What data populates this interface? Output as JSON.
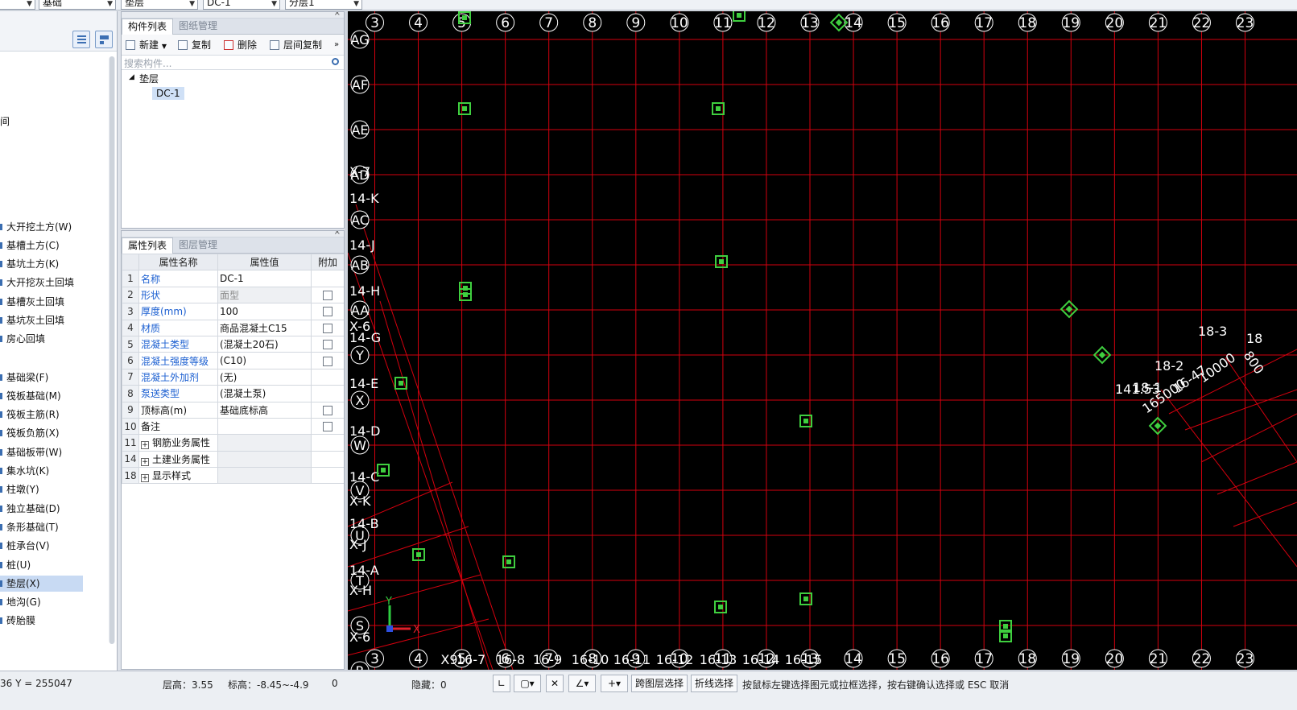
{
  "top_combos": {
    "c1": "",
    "c2": "基础",
    "c3": "垫层",
    "c4": "DC-1",
    "c5": "分层1"
  },
  "left_tree": {
    "items": [
      {
        "label": "大开挖土方(W)"
      },
      {
        "label": "基槽土方(C)"
      },
      {
        "label": "基坑土方(K)"
      },
      {
        "label": "大开挖灰土回填"
      },
      {
        "label": "基槽灰土回填"
      },
      {
        "label": "基坑灰土回填"
      },
      {
        "label": "房心回填"
      },
      {
        "label": "基础梁(F)"
      },
      {
        "label": "筏板基础(M)"
      },
      {
        "label": "筏板主筋(R)"
      },
      {
        "label": "筏板负筋(X)"
      },
      {
        "label": "基础板带(W)"
      },
      {
        "label": "集水坑(K)"
      },
      {
        "label": "柱墩(Y)"
      },
      {
        "label": "独立基础(D)"
      },
      {
        "label": "条形基础(T)"
      },
      {
        "label": "桩承台(V)"
      },
      {
        "label": "桩(U)"
      },
      {
        "label": "垫层(X)"
      },
      {
        "label": "地沟(G)"
      },
      {
        "label": "砖胎膜"
      }
    ],
    "stray_glyph": "间"
  },
  "component_panel": {
    "tabs": [
      "构件列表",
      "图纸管理"
    ],
    "toolbar": [
      "新建",
      "复制",
      "删除",
      "层间复制"
    ],
    "search_placeholder": "搜索构件...",
    "tree_root": "垫层",
    "tree_child": "DC-1",
    "more": "»"
  },
  "property_panel": {
    "tabs": [
      "属性列表",
      "图层管理"
    ],
    "headers": [
      "属性名称",
      "属性值",
      "附加"
    ],
    "rows": [
      {
        "n": "1",
        "name": "名称",
        "value": "DC-1",
        "check": false,
        "blue": true
      },
      {
        "n": "2",
        "name": "形状",
        "value": "面型",
        "check": true,
        "blue": true,
        "gray": true
      },
      {
        "n": "3",
        "name": "厚度(mm)",
        "value": "100",
        "check": true,
        "blue": true
      },
      {
        "n": "4",
        "name": "材质",
        "value": "商品混凝土C15",
        "check": true,
        "blue": true
      },
      {
        "n": "5",
        "name": "混凝土类型",
        "value": "(混凝土20石)",
        "check": true,
        "blue": true
      },
      {
        "n": "6",
        "name": "混凝土强度等级",
        "value": "(C10)",
        "check": true,
        "blue": true
      },
      {
        "n": "7",
        "name": "混凝土外加剂",
        "value": "(无)",
        "check": false,
        "blue": true
      },
      {
        "n": "8",
        "name": "泵送类型",
        "value": "(混凝土泵)",
        "check": false,
        "blue": true
      },
      {
        "n": "9",
        "name": "顶标高(m)",
        "value": "基础底标高",
        "check": true,
        "blue": false
      },
      {
        "n": "10",
        "name": "备注",
        "value": "",
        "check": true,
        "blue": false
      },
      {
        "n": "11",
        "name": "钢筋业务属性",
        "value": "",
        "group": true
      },
      {
        "n": "14",
        "name": "土建业务属性",
        "value": "",
        "group": true
      },
      {
        "n": "18",
        "name": "显示样式",
        "value": "",
        "group": true
      }
    ]
  },
  "cad": {
    "col_labels": [
      "3",
      "4",
      "5",
      "6",
      "7",
      "8",
      "9",
      "10",
      "11",
      "12",
      "13",
      "14",
      "15",
      "16",
      "17",
      "18",
      "19",
      "20",
      "21",
      "22",
      "23"
    ],
    "row_labels": [
      "AG",
      "AF",
      "AE",
      "AD",
      "AC",
      "AB",
      "AA",
      "Y",
      "X",
      "W",
      "V",
      "U",
      "T",
      "S",
      "R"
    ],
    "diag_labels": [
      "X-7",
      "14-K",
      "14-J",
      "14-H",
      "X-6",
      "14-G",
      "14-E",
      "14-D",
      "14-C",
      "X-K",
      "14-B",
      "X-J",
      "14-A",
      "X-H",
      "X-6"
    ],
    "bottom_extra": [
      "X9",
      "16-7",
      "16-8",
      "16-9",
      "16-10",
      "16-11",
      "16-12",
      "16-13",
      "16-14",
      "16-15"
    ],
    "right_labels": [
      "18-3",
      "18-2",
      "18-1",
      "141.53",
      "16-47",
      "10000",
      "165000",
      "800",
      "18"
    ],
    "axis_x": "X",
    "axis_y": "Y",
    "colors": {
      "grid": "#d4000e",
      "bubble": "#ffffff",
      "marker": "#3fcf3f"
    }
  },
  "status": {
    "coords": "36 Y = 255047",
    "floor_height": "层高：3.55",
    "elevation": "标高：-8.45~-4.9",
    "zero": "0",
    "hidden": "隐藏：0",
    "btn_cross": "跨图层选择",
    "btn_polyline": "折线选择",
    "hint": "按鼠标左键选择图元或拉框选择，按右键确认选择或 ESC 取消"
  }
}
